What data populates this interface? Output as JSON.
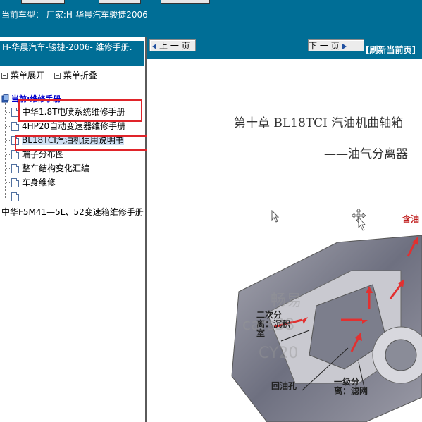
{
  "header": {
    "model_text": "当前车型：  厂家:H-华晨汽车骏捷2006"
  },
  "sidebar": {
    "title": "H-华晨汽车-骏捷-2006- 维修手册.",
    "expand_label": "菜单展开",
    "collapse_label": "菜单折叠",
    "root_label": "当前:维修手册",
    "items": [
      {
        "label": "中华1.8T电喷系统维修手册"
      },
      {
        "label": "4HP20自动变速器维修手册"
      },
      {
        "label": "BL18TCI汽油机使用说明书",
        "selected": true
      },
      {
        "label": "端子分布图"
      },
      {
        "label": "整车结构变化汇编"
      },
      {
        "label": "车身维修"
      },
      {
        "label": ""
      }
    ],
    "extra_item": "中华F5M41—5L、52变速箱维修手册"
  },
  "toolbar": {
    "prev_label": "上 一 页",
    "next_label": "下 一 页",
    "refresh_label": "[刷新当前页]"
  },
  "document": {
    "chapter_title": "第十章  BL18TCI 汽油机曲轴箱",
    "chapter_subtitle": "——油气分离器",
    "labels": {
      "top_right": "含油",
      "second_sep": "二次分离：沉积室",
      "first_sep": "一级分离：滤网",
      "oil_return": "回油孔"
    },
    "watermarks": [
      "畅易",
      "cars38",
      "CY20"
    ]
  },
  "colors": {
    "header_bg": "#006e96",
    "annotation": "#e0242a",
    "selection": "#cfe0f4"
  }
}
